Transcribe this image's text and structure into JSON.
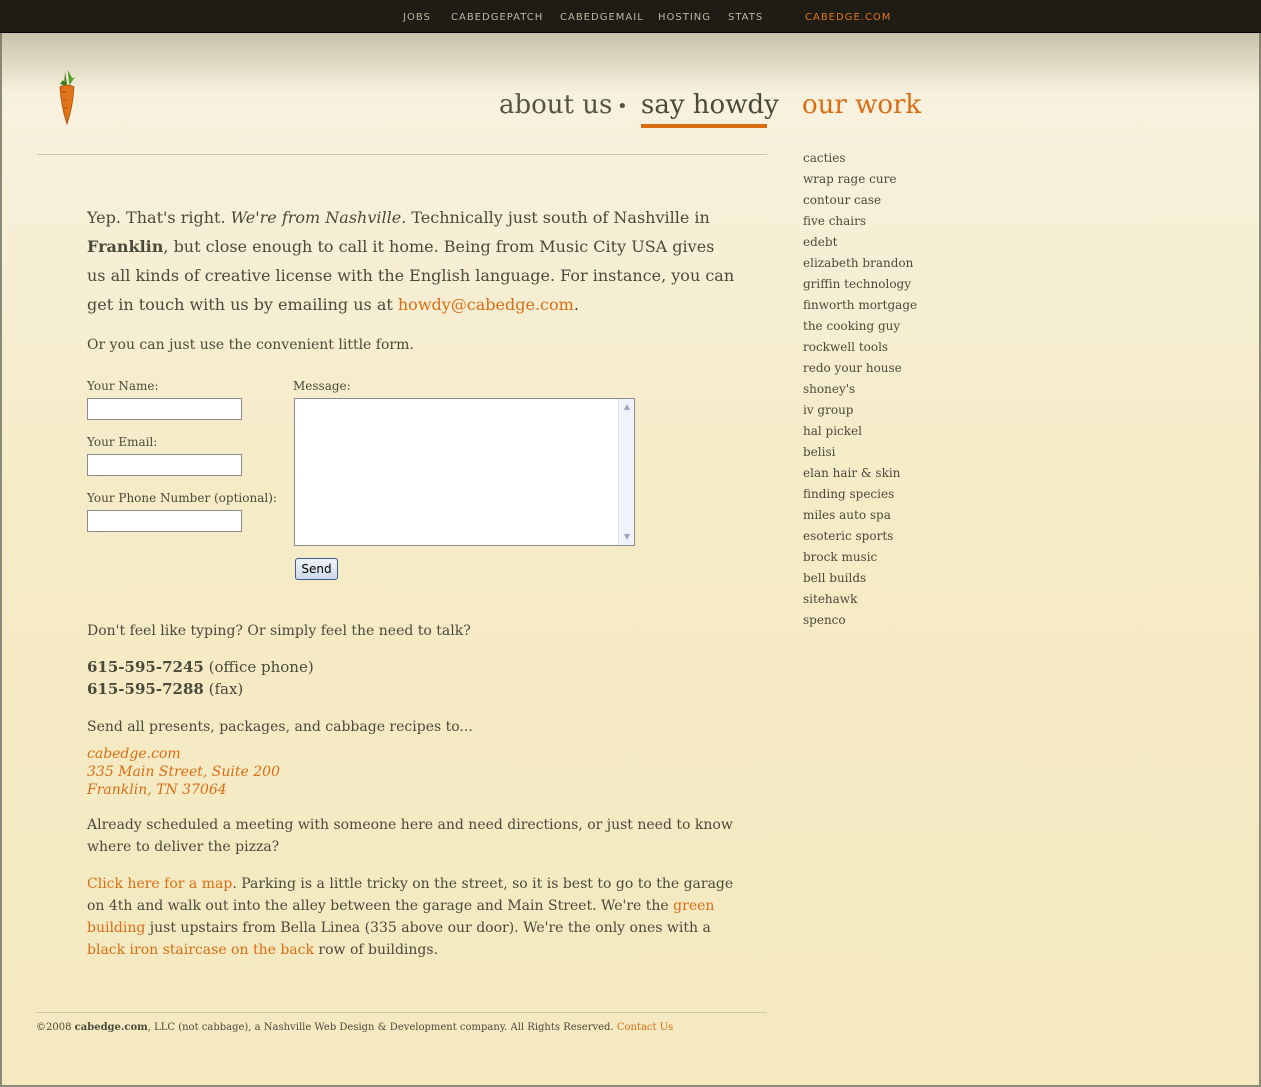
{
  "topnav": {
    "jobs": "JOBS",
    "patch": "CABEDGEPATCH",
    "mail": "CABEDGEMAIL",
    "hosting": "HOSTING",
    "stats": "STATS",
    "brand": "CABEDGE.COM"
  },
  "logo": {
    "icon": "carrot-icon"
  },
  "mainnav": {
    "about": "about us",
    "dot": "•",
    "howdy": "say howdy",
    "ourwork": "our work"
  },
  "intro": {
    "t1": "Yep. That's right. ",
    "t2": "We're from Nashville.",
    "t3": " Technically just south of Nashville in ",
    "t4": "Franklin",
    "t5": ", but close enough to call it home. Being from Music City USA gives us all kinds of creative license with the English language. For instance, you can get in touch with us by emailing us at ",
    "email": "howdy@cabedge.com",
    "t6": "."
  },
  "form_intro": "Or you can just use the convenient little form.",
  "form": {
    "name_label": "Your Name:",
    "email_label": "Your Email:",
    "phone_label": "Your Phone Number (optional):",
    "message_label": "Message:",
    "send": "Send"
  },
  "talk": "Don't feel like typing? Or simply feel the need to talk?",
  "phones": {
    "office": "615-595-7245",
    "office_note": "(office phone)",
    "fax": "615-595-7288",
    "fax_note": "(fax)"
  },
  "send_to": "Send all presents, packages, and cabbage recipes to...",
  "address": {
    "line1": "cabedge.com",
    "line2": "335 Main Street, Suite 200",
    "line3": "Franklin, TN 37064"
  },
  "directions_q": "Already scheduled a meeting with someone here and need directions, or just need to know where to deliver the pizza?",
  "directions": {
    "map_link": "Click here for a map",
    "t1": ". Parking is a little tricky on the street, so it is best to go to the garage on 4th and walk out into the alley between the garage and Main Street. We're the ",
    "green": "green building",
    "t2": " just upstairs from Bella Linea (335 above our door). We're the only ones with a ",
    "stairs": "black iron staircase on the back",
    "t3": " row of buildings."
  },
  "sidebar": [
    "cacties",
    "wrap rage cure",
    "contour case",
    "five chairs",
    "edebt",
    "elizabeth brandon",
    "griffin technology",
    "finworth mortgage",
    "the cooking guy",
    "rockwell tools",
    "redo your house",
    "shoney's",
    "iv group",
    "hal pickel",
    "belisi",
    "elan hair & skin",
    "finding species",
    "miles auto spa",
    "esoteric sports",
    "brock music",
    "bell builds",
    "sitehawk",
    "spenco"
  ],
  "footer": {
    "copy": "©2008 ",
    "brand": "cabedge.com",
    "rest": ", LLC (not cabbage), a Nashville Web Design & Development company. All Rights Reserved. ",
    "contact": "Contact Us"
  },
  "colors": {
    "accent": "#d96d14",
    "topbar": "#1f1b15",
    "text": "#4a4a3a"
  }
}
